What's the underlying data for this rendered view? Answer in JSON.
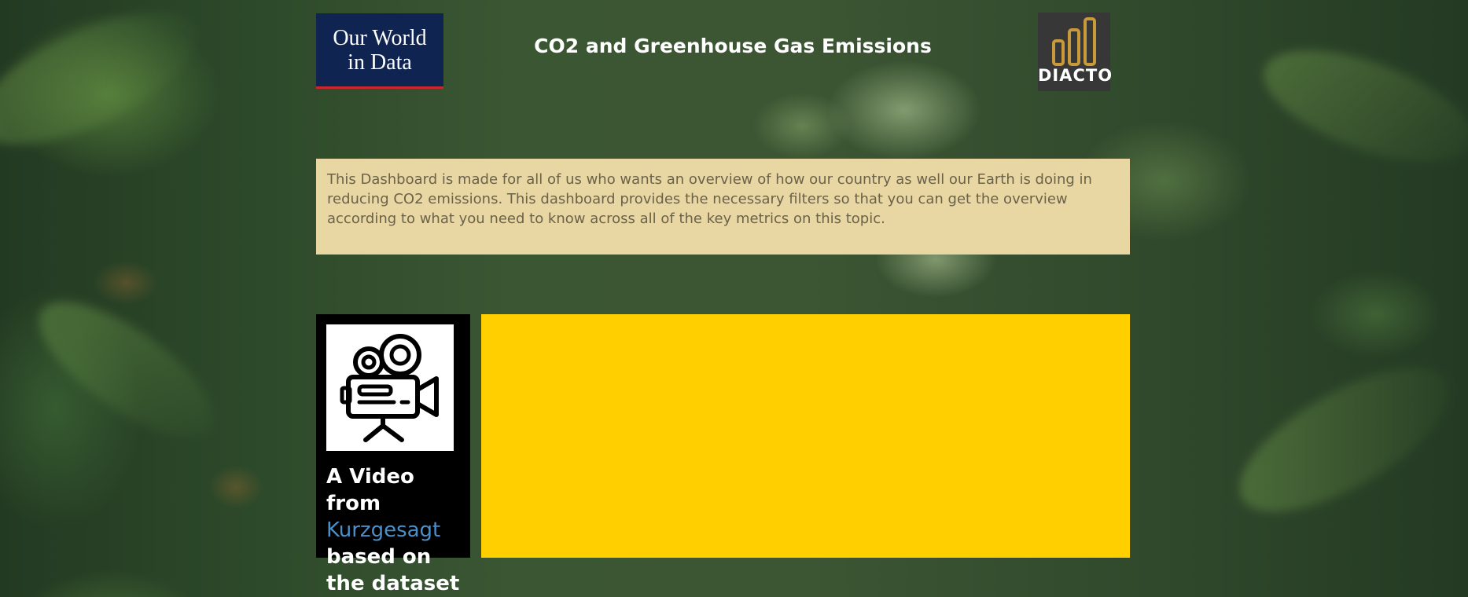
{
  "header": {
    "owid_logo_line1": "Our World",
    "owid_logo_line2": "in Data",
    "title": "CO2 and Greenhouse Gas Emissions",
    "diacto_logo_text": "DIACTO"
  },
  "intro": {
    "text": "This Dashboard is made for all of us who wants an overview of how our country as well our Earth is doing in reducing CO2 emissions. This dashboard provides the necessary filters so that you can get the overview according to what you need to know across all of the key metrics on this topic."
  },
  "video_card": {
    "icon": "video-camera-icon",
    "caption_before": "A Video from",
    "link_text": "Kurzgesagt",
    "caption_after": "based on the dataset"
  },
  "colors": {
    "owid_navy": "#0f2451",
    "owid_red": "#c8282d",
    "diacto_gold": "#c99a3c",
    "intro_bg": "#e8d6a3",
    "video_panel_bg": "#ffcf00",
    "link_blue": "#4a8fc9"
  }
}
